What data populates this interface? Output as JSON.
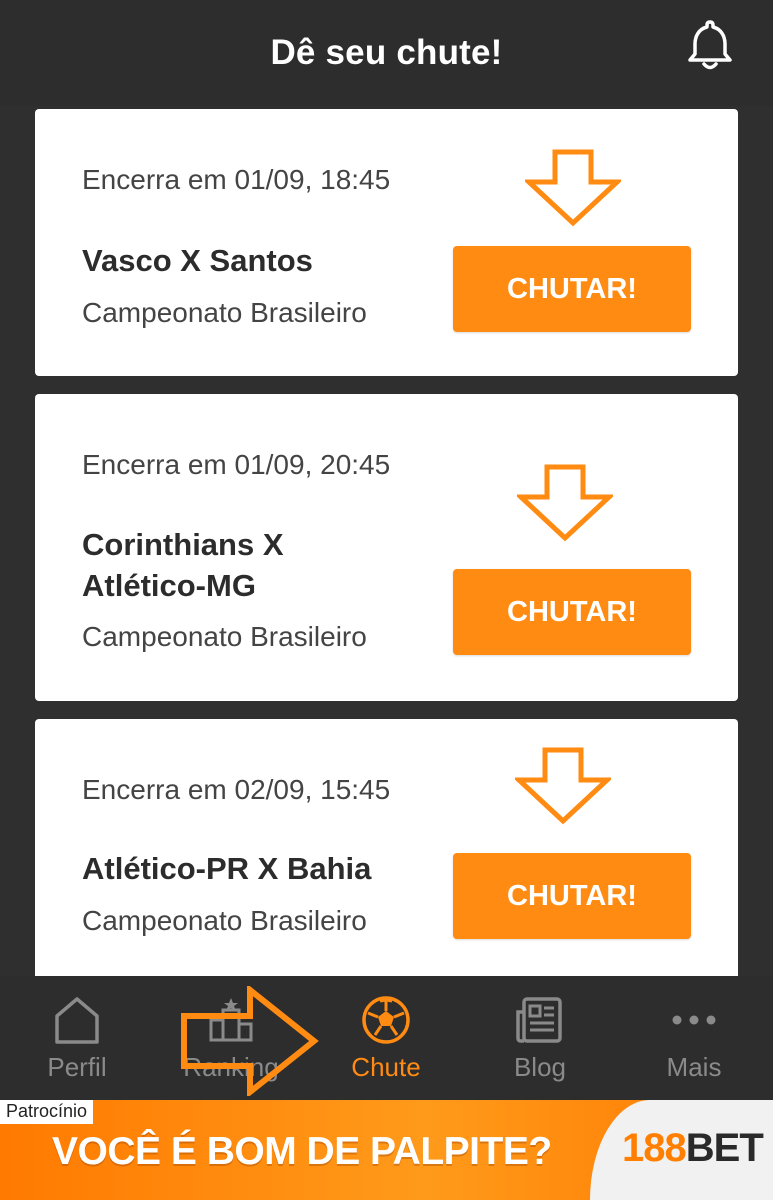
{
  "header": {
    "title": "Dê seu chute!"
  },
  "matches": [
    {
      "closes": "Encerra em 01/09, 18:45",
      "match": "Vasco X Santos",
      "league": "Campeonato Brasileiro",
      "button": "CHUTAR!"
    },
    {
      "closes": "Encerra em 01/09, 20:45",
      "match": "Corinthians X Atlético-MG",
      "league": "Campeonato Brasileiro",
      "button": "CHUTAR!"
    },
    {
      "closes": "Encerra em 02/09, 15:45",
      "match": "Atlético-PR X Bahia",
      "league": "Campeonato Brasileiro",
      "button": "CHUTAR!"
    }
  ],
  "nav": {
    "items": [
      {
        "label": "Perfil",
        "icon": "home-icon"
      },
      {
        "label": "Ranking",
        "icon": "trophy-icon"
      },
      {
        "label": "Chute",
        "icon": "soccer-ball-icon",
        "active": true
      },
      {
        "label": "Blog",
        "icon": "newspaper-icon"
      },
      {
        "label": "Mais",
        "icon": "more-dots-icon"
      }
    ]
  },
  "ad": {
    "sponsor_label": "Patrocínio",
    "headline": "VOCÊ É BOM DE PALPITE?",
    "brand_number": "188",
    "brand_word": "BET"
  },
  "colors": {
    "accent": "#ff8b12",
    "header_bg": "#2d2d2d",
    "content_bg": "#2f2f2f",
    "nav_inactive": "#8a8a8a"
  }
}
